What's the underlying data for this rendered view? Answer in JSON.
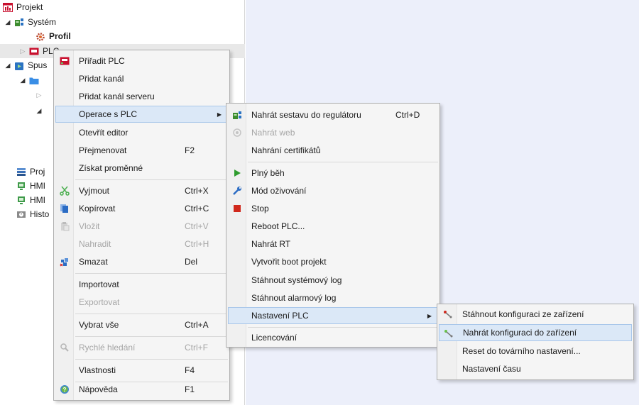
{
  "tree": {
    "projekt": "Projekt",
    "system": "Systém",
    "profil": "Profil",
    "plc": "PLC",
    "spus": "Spus",
    "proj": "Proj",
    "hmi1": "HMI",
    "hmi2": "HMI",
    "hist": "Histo"
  },
  "menu1": {
    "items": [
      {
        "label": "Přiřadit PLC",
        "shortcut": ""
      },
      {
        "label": "Přidat kanál",
        "shortcut": ""
      },
      {
        "label": "Přidat kanál serveru",
        "shortcut": ""
      },
      {
        "label": "Operace s PLC",
        "shortcut": ""
      },
      {
        "label": "Otevřít editor",
        "shortcut": ""
      },
      {
        "label": "Přejmenovat",
        "shortcut": "F2"
      },
      {
        "label": "Získat proměnné",
        "shortcut": ""
      },
      {
        "label": "Vyjmout",
        "shortcut": "Ctrl+X"
      },
      {
        "label": "Kopírovat",
        "shortcut": "Ctrl+C"
      },
      {
        "label": "Vložit",
        "shortcut": "Ctrl+V"
      },
      {
        "label": "Nahradit",
        "shortcut": "Ctrl+H"
      },
      {
        "label": "Smazat",
        "shortcut": "Del"
      },
      {
        "label": "Importovat",
        "shortcut": ""
      },
      {
        "label": "Exportovat",
        "shortcut": ""
      },
      {
        "label": "Vybrat vše",
        "shortcut": "Ctrl+A"
      },
      {
        "label": "Rychlé hledání",
        "shortcut": "Ctrl+F"
      },
      {
        "label": "Vlastnosti",
        "shortcut": "F4"
      },
      {
        "label": "Nápověda",
        "shortcut": "F1"
      }
    ]
  },
  "menu2": {
    "items": [
      {
        "label": "Nahrát sestavu do regulátoru",
        "shortcut": "Ctrl+D"
      },
      {
        "label": "Nahrát web",
        "shortcut": ""
      },
      {
        "label": "Nahrání certifikátů",
        "shortcut": ""
      },
      {
        "label": "Plný běh",
        "shortcut": ""
      },
      {
        "label": "Mód oživování",
        "shortcut": ""
      },
      {
        "label": "Stop",
        "shortcut": ""
      },
      {
        "label": "Reboot PLC...",
        "shortcut": ""
      },
      {
        "label": "Nahrát RT",
        "shortcut": ""
      },
      {
        "label": "Vytvořit boot projekt",
        "shortcut": ""
      },
      {
        "label": "Stáhnout systémový log",
        "shortcut": ""
      },
      {
        "label": "Stáhnout alarmový log",
        "shortcut": ""
      },
      {
        "label": "Nastavení PLC",
        "shortcut": ""
      },
      {
        "label": "Licencování",
        "shortcut": ""
      }
    ]
  },
  "menu3": {
    "items": [
      {
        "label": "Stáhnout konfiguraci ze zařízení"
      },
      {
        "label": "Nahrát konfiguraci do zařízení"
      },
      {
        "label": "Reset do továrního nastavení..."
      },
      {
        "label": "Nastavení času"
      }
    ]
  },
  "colors": {
    "accent_hover": "#dbe8f7",
    "right_pane": "#eceffa",
    "plc_red": "#c8102e"
  }
}
